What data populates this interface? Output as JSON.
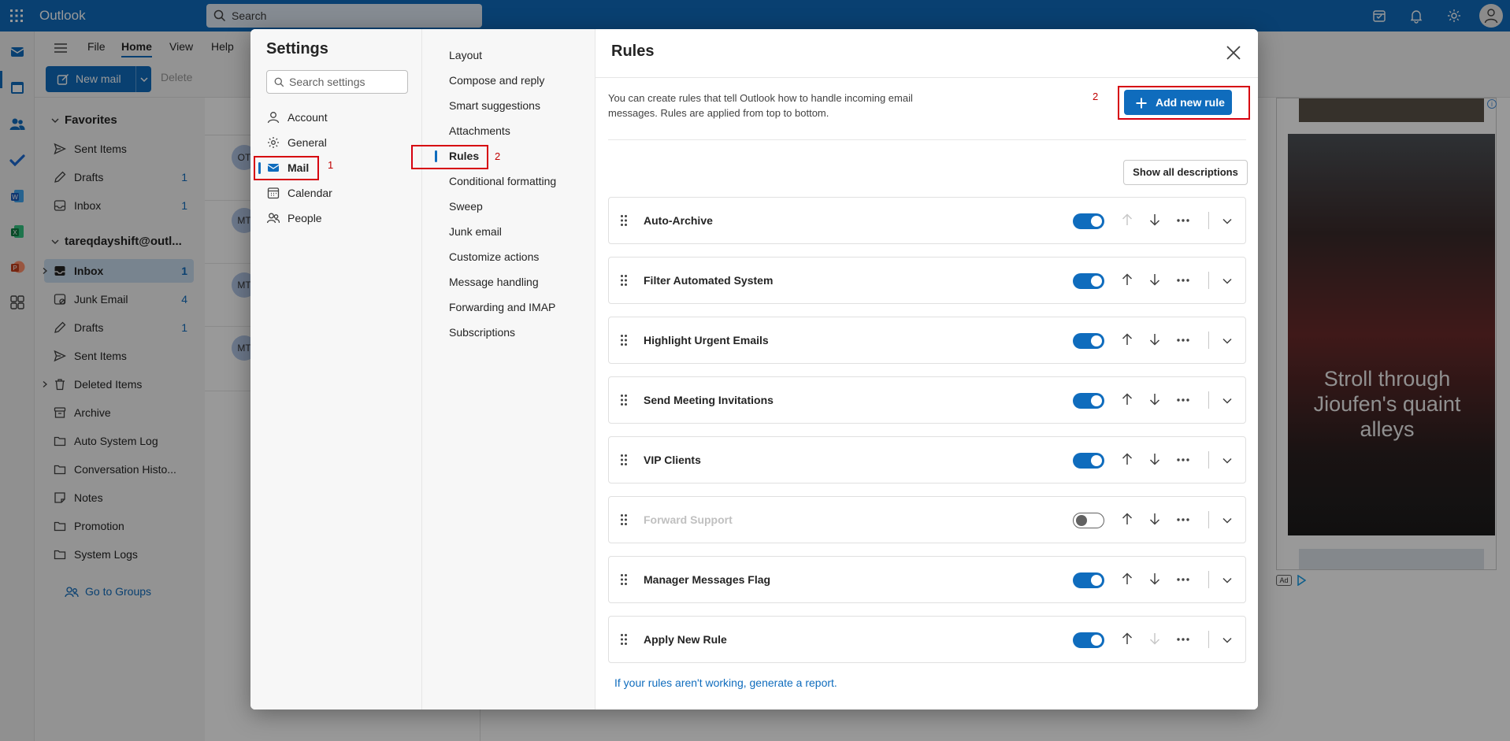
{
  "topbar": {
    "app_name": "Outlook",
    "search_placeholder": "Search"
  },
  "ribbon": {
    "tabs": [
      "File",
      "Home",
      "View",
      "Help"
    ],
    "active_tab": "Home",
    "new_mail_label": "New mail",
    "delete_label": "Delete"
  },
  "folders": {
    "favorites_label": "Favorites",
    "favorites": [
      {
        "label": "Sent Items",
        "count": ""
      },
      {
        "label": "Drafts",
        "count": "1"
      },
      {
        "label": "Inbox",
        "count": "1"
      }
    ],
    "account_label": "tareqdayshift@outl...",
    "account_folders": [
      {
        "label": "Inbox",
        "count": "1"
      },
      {
        "label": "Junk Email",
        "count": "4"
      },
      {
        "label": "Drafts",
        "count": "1"
      },
      {
        "label": "Sent Items",
        "count": ""
      },
      {
        "label": "Deleted Items",
        "count": ""
      },
      {
        "label": "Archive",
        "count": ""
      },
      {
        "label": "Auto System Log",
        "count": ""
      },
      {
        "label": "Conversation Histo...",
        "count": ""
      },
      {
        "label": "Notes",
        "count": ""
      },
      {
        "label": "Promotion",
        "count": ""
      },
      {
        "label": "System Logs",
        "count": ""
      }
    ],
    "groups_link": "Go to Groups"
  },
  "message_list": {
    "avatars": [
      "OT",
      "MT",
      "MT",
      "MT"
    ]
  },
  "ad": {
    "headline": "Stroll through Jioufen's quaint alleys",
    "badge": "Ad",
    "info": "i"
  },
  "settings": {
    "title": "Settings",
    "search_placeholder": "Search settings",
    "categories": [
      "Account",
      "General",
      "Mail",
      "Calendar",
      "People"
    ],
    "selected_category": "Mail",
    "mail_subsections": [
      "Layout",
      "Compose and reply",
      "Smart suggestions",
      "Attachments",
      "Rules",
      "Conditional formatting",
      "Sweep",
      "Junk email",
      "Customize actions",
      "Message handling",
      "Forwarding and IMAP",
      "Subscriptions"
    ],
    "selected_subsection": "Rules"
  },
  "annotations": {
    "mail": "1",
    "rules": "2",
    "add_rule": "2"
  },
  "rules_page": {
    "title": "Rules",
    "description": "You can create rules that tell Outlook how to handle incoming email messages. Rules are applied from top to bottom.",
    "add_button": "Add new rule",
    "show_all": "Show all descriptions",
    "rules": [
      {
        "name": "Auto-Archive",
        "enabled": true
      },
      {
        "name": "Filter Automated System",
        "enabled": true
      },
      {
        "name": "Highlight Urgent Emails",
        "enabled": true
      },
      {
        "name": "Send Meeting Invitations",
        "enabled": true
      },
      {
        "name": "VIP Clients",
        "enabled": true
      },
      {
        "name": "Forward Support",
        "enabled": false
      },
      {
        "name": "Manager Messages Flag",
        "enabled": true
      },
      {
        "name": "Apply New Rule",
        "enabled": true
      }
    ],
    "report_link": "If your rules aren't working, generate a report."
  },
  "colors": {
    "brand": "#0f6cbd",
    "highlight": "#d6000f"
  }
}
